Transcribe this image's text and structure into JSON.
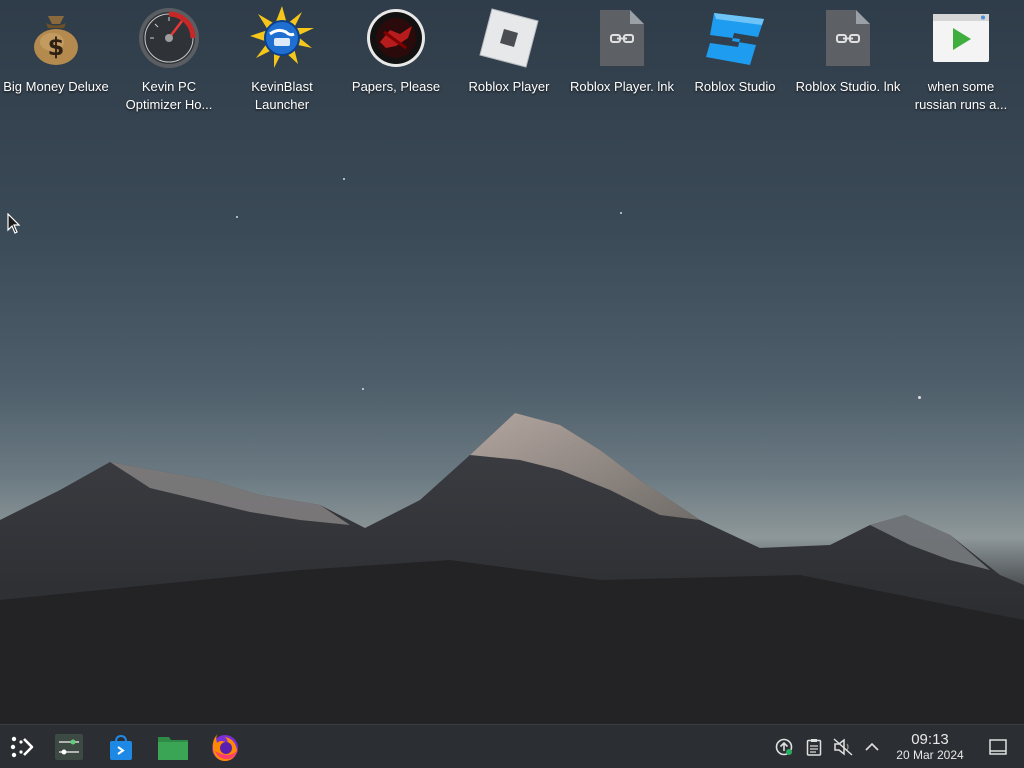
{
  "desktop": {
    "icons": [
      {
        "label": "Big Money Deluxe",
        "icon": "money-bag-icon"
      },
      {
        "label": "Kevin PC Optimizer Ho...",
        "icon": "speedometer-icon"
      },
      {
        "label": "KevinBlast Launcher",
        "icon": "sunburst-globe-icon"
      },
      {
        "label": "Papers, Please",
        "icon": "papers-please-emblem-icon"
      },
      {
        "label": "Roblox Player",
        "icon": "roblox-logo-icon"
      },
      {
        "label": "Roblox Player. lnk",
        "icon": "shortcut-file-icon"
      },
      {
        "label": "Roblox Studio",
        "icon": "roblox-studio-icon"
      },
      {
        "label": "Roblox Studio. lnk",
        "icon": "shortcut-file-icon"
      },
      {
        "label": "when some russian runs a...",
        "icon": "video-play-icon"
      }
    ]
  },
  "taskbar": {
    "launchers": [
      {
        "name": "application-launcher",
        "icon": "kde-launcher-icon"
      },
      {
        "name": "system-settings",
        "icon": "settings-sliders-icon"
      },
      {
        "name": "discover-store",
        "icon": "store-bag-icon"
      },
      {
        "name": "file-manager",
        "icon": "folder-icon"
      },
      {
        "name": "firefox",
        "icon": "firefox-icon"
      }
    ],
    "tray": [
      {
        "name": "updates",
        "icon": "update-arrow-icon"
      },
      {
        "name": "clipboard",
        "icon": "clipboard-icon"
      },
      {
        "name": "volume",
        "icon": "volume-muted-icon"
      },
      {
        "name": "show-hidden",
        "icon": "chevron-up-icon"
      }
    ],
    "clock": {
      "time": "09:13",
      "date": "20 Mar 2024"
    }
  },
  "colors": {
    "taskbar_bg": "#2b2e32",
    "label_text": "#ffffff",
    "roblox_studio_blue": "#1e9df0",
    "folder_green": "#3aa655"
  }
}
